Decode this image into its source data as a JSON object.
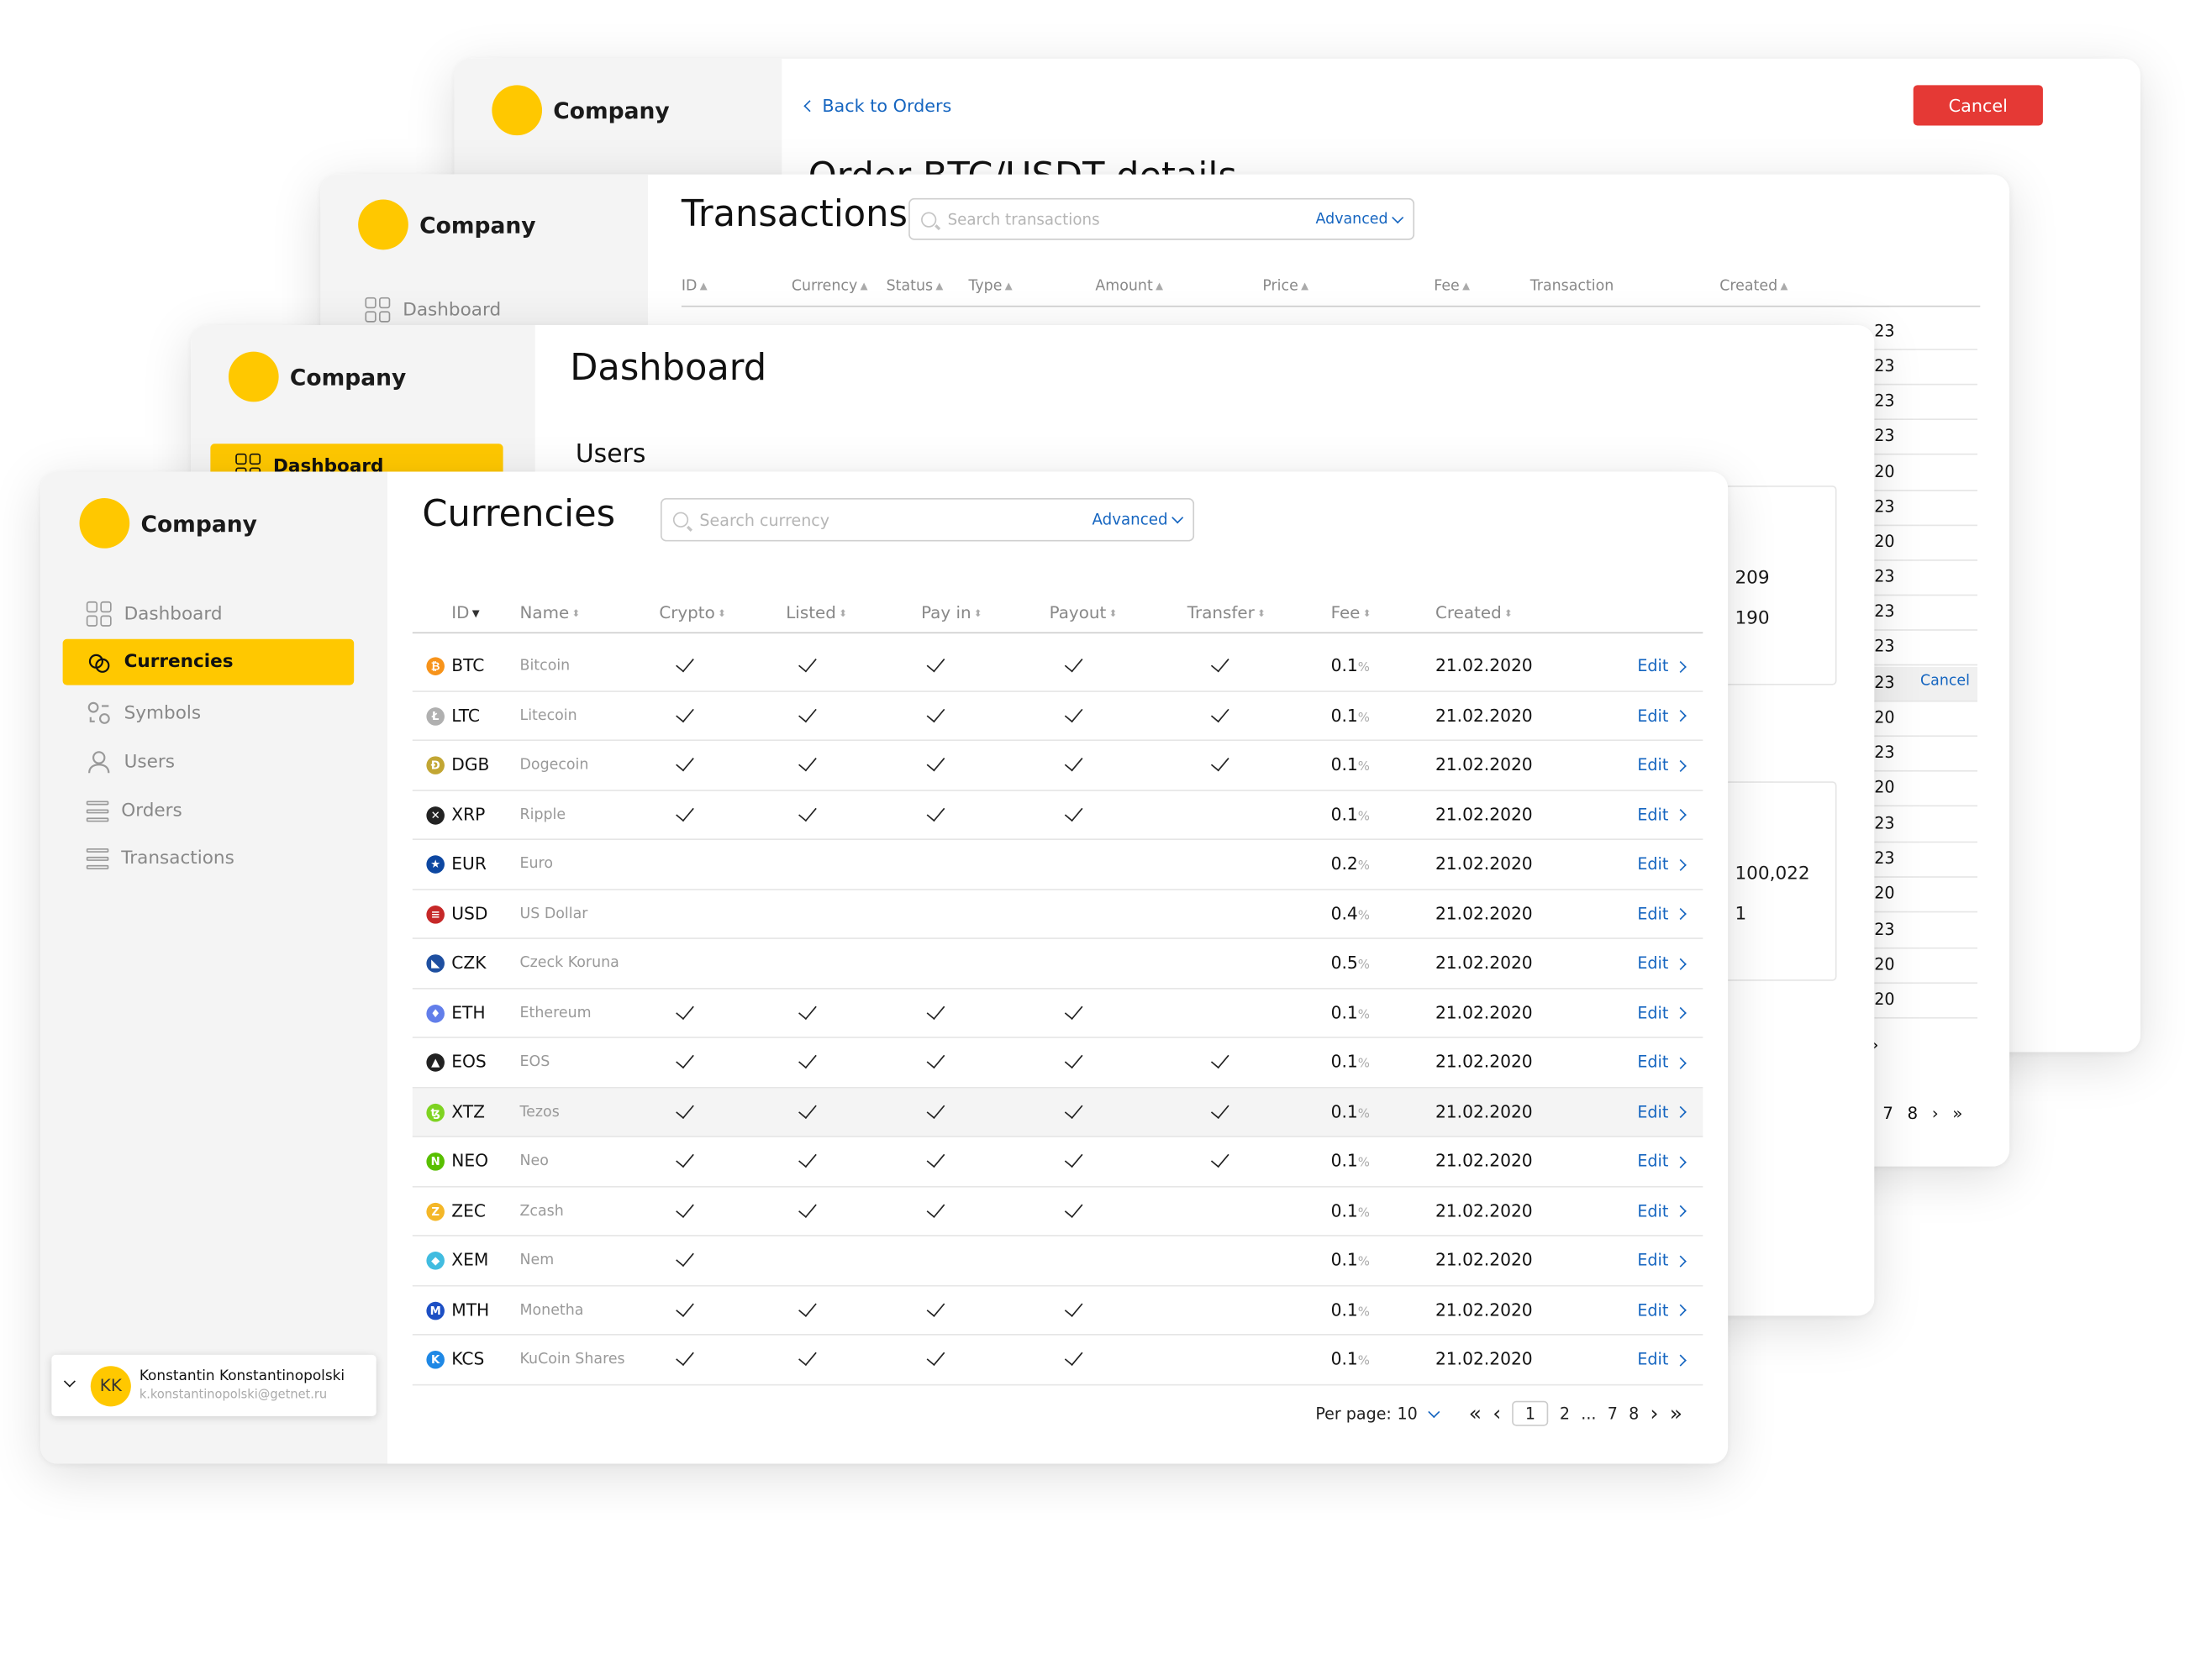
{
  "brand": {
    "name": "Company",
    "accent": "#ffc800",
    "link": "#1565c0",
    "danger": "#e53935"
  },
  "order_window": {
    "back_label": "Back to Orders",
    "cancel_label": "Cancel",
    "title": "Order BTC/USDT details"
  },
  "tx_window": {
    "title": "Transactions",
    "search_placeholder": "Search transactions",
    "advanced_label": "Advanced",
    "nav_dashboard": "Dashboard",
    "columns": [
      "ID",
      "Currency",
      "Status",
      "Type",
      "Amount",
      "Price",
      "Fee",
      "Transaction",
      "Created"
    ],
    "row_fragments": [
      "23",
      "23",
      "23",
      "23",
      "20",
      "23",
      "20",
      "23",
      "23",
      "23",
      "23",
      "20",
      "23",
      "20",
      "23",
      "23",
      "20",
      "23",
      "20",
      "20"
    ],
    "row_cancel_label": "Cancel",
    "pager_pages": [
      "7",
      "8"
    ]
  },
  "dash_window": {
    "title": "Dashboard",
    "nav_dashboard": "Dashboard",
    "section_users": "Users",
    "card1_values": [
      "209",
      "190"
    ],
    "card2_values": [
      "100,022",
      "1"
    ]
  },
  "main": {
    "title": "Currencies",
    "search_placeholder": "Search currency",
    "advanced_label": "Advanced",
    "columns": [
      "ID",
      "Name",
      "Crypto",
      "Listed",
      "Pay in",
      "Payout",
      "Transfer",
      "Fee",
      "Created"
    ],
    "edit_label": "Edit",
    "pct_sign": "%",
    "nav": [
      {
        "label": "Dashboard",
        "icon": "dashboard-icon"
      },
      {
        "label": "Currencies",
        "icon": "currencies-icon"
      },
      {
        "label": "Symbols",
        "icon": "symbols-icon"
      },
      {
        "label": "Users",
        "icon": "users-icon"
      },
      {
        "label": "Orders",
        "icon": "orders-icon"
      },
      {
        "label": "Transactions",
        "icon": "transactions-icon"
      }
    ],
    "active_nav": "Currencies",
    "rows": [
      {
        "id": "BTC",
        "name": "Bitcoin",
        "crypto": true,
        "listed": true,
        "payin": true,
        "payout": true,
        "transfer": true,
        "fee": "0.1",
        "created": "21.02.2020",
        "icon_color": "#f7931a",
        "glyph": "₿"
      },
      {
        "id": "LTC",
        "name": "Litecoin",
        "crypto": true,
        "listed": true,
        "payin": true,
        "payout": true,
        "transfer": true,
        "fee": "0.1",
        "created": "21.02.2020",
        "icon_color": "#b0b0b0",
        "glyph": "Ł"
      },
      {
        "id": "DGB",
        "name": "Dogecoin",
        "crypto": true,
        "listed": true,
        "payin": true,
        "payout": true,
        "transfer": true,
        "fee": "0.1",
        "created": "21.02.2020",
        "icon_color": "#c2a633",
        "glyph": "Ð"
      },
      {
        "id": "XRP",
        "name": "Ripple",
        "crypto": true,
        "listed": true,
        "payin": true,
        "payout": true,
        "transfer": false,
        "fee": "0.1",
        "created": "21.02.2020",
        "icon_color": "#222222",
        "glyph": "✕"
      },
      {
        "id": "EUR",
        "name": "Euro",
        "crypto": false,
        "listed": false,
        "payin": false,
        "payout": false,
        "transfer": false,
        "fee": "0.2",
        "created": "21.02.2020",
        "icon_color": "#0d47a1",
        "glyph": "★"
      },
      {
        "id": "USD",
        "name": "US Dollar",
        "crypto": false,
        "listed": false,
        "payin": false,
        "payout": false,
        "transfer": false,
        "fee": "0.4",
        "created": "21.02.2020",
        "icon_color": "#c62828",
        "glyph": "≡"
      },
      {
        "id": "CZK",
        "name": "Czeck Koruna",
        "crypto": false,
        "listed": false,
        "payin": false,
        "payout": false,
        "transfer": false,
        "fee": "0.5",
        "created": "21.02.2020",
        "icon_color": "#1e4fa0",
        "glyph": "◣"
      },
      {
        "id": "ETH",
        "name": "Ethereum",
        "crypto": true,
        "listed": true,
        "payin": true,
        "payout": true,
        "transfer": false,
        "fee": "0.1",
        "created": "21.02.2020",
        "icon_color": "#627eea",
        "glyph": "♦"
      },
      {
        "id": "EOS",
        "name": "EOS",
        "crypto": true,
        "listed": true,
        "payin": true,
        "payout": true,
        "transfer": true,
        "fee": "0.1",
        "created": "21.02.2020",
        "icon_color": "#222222",
        "glyph": "▲"
      },
      {
        "id": "XTZ",
        "name": "Tezos",
        "crypto": true,
        "listed": true,
        "payin": true,
        "payout": true,
        "transfer": true,
        "fee": "0.1",
        "created": "21.02.2020",
        "icon_color": "#7ed321",
        "glyph": "ꜩ",
        "highlight": true
      },
      {
        "id": "NEO",
        "name": "Neo",
        "crypto": true,
        "listed": true,
        "payin": true,
        "payout": true,
        "transfer": true,
        "fee": "0.1",
        "created": "21.02.2020",
        "icon_color": "#58bf00",
        "glyph": "N"
      },
      {
        "id": "ZEC",
        "name": "Zcash",
        "crypto": true,
        "listed": true,
        "payin": true,
        "payout": true,
        "transfer": false,
        "fee": "0.1",
        "created": "21.02.2020",
        "icon_color": "#f4b728",
        "glyph": "Z"
      },
      {
        "id": "XEM",
        "name": "Nem",
        "crypto": true,
        "listed": false,
        "payin": false,
        "payout": false,
        "transfer": false,
        "fee": "0.1",
        "created": "21.02.2020",
        "icon_color": "#41bce0",
        "glyph": "◆"
      },
      {
        "id": "MTH",
        "name": "Monetha",
        "crypto": true,
        "listed": true,
        "payin": true,
        "payout": true,
        "transfer": false,
        "fee": "0.1",
        "created": "21.02.2020",
        "icon_color": "#1d4fc4",
        "glyph": "M"
      },
      {
        "id": "KCS",
        "name": "KuCoin Shares",
        "crypto": true,
        "listed": true,
        "payin": true,
        "payout": true,
        "transfer": false,
        "fee": "0.1",
        "created": "21.02.2020",
        "icon_color": "#1e88e5",
        "glyph": "K"
      }
    ],
    "pagination": {
      "per_page_label": "Per page:",
      "per_page_value": "10",
      "current": "1",
      "pages": [
        "2",
        "...",
        "7",
        "8"
      ]
    },
    "user": {
      "initials": "KK",
      "name": "Konstantin Konstantinopolski",
      "email": "k.konstantinopolski@getnet.ru"
    }
  }
}
